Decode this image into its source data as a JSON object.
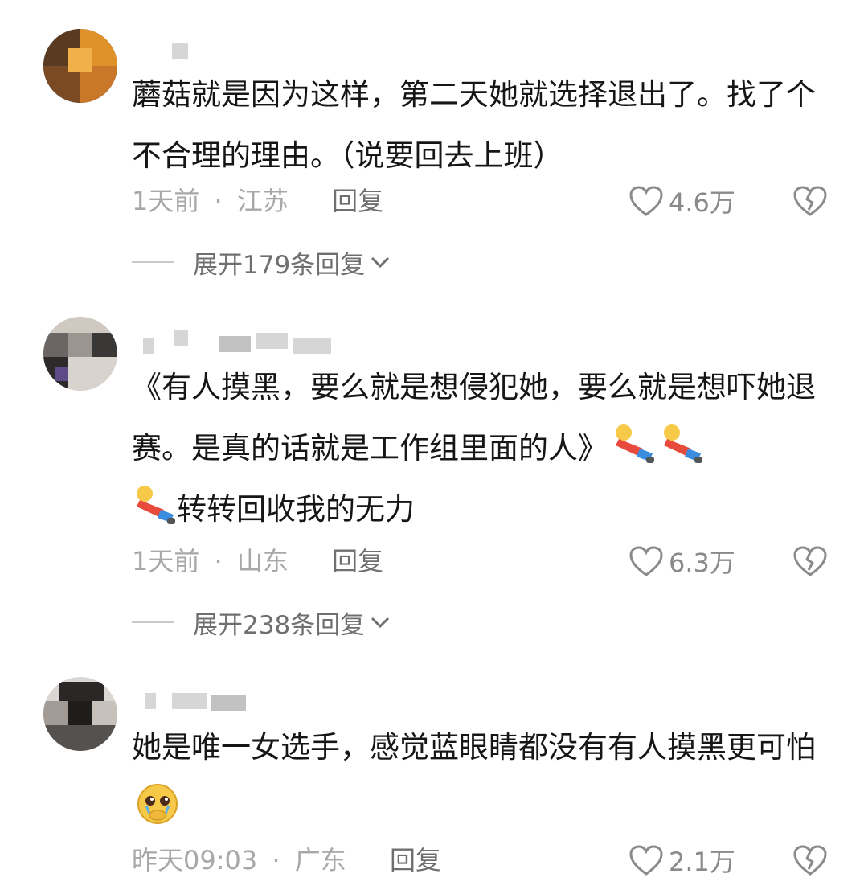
{
  "comments": [
    {
      "text": "蘑菇就是因为这样，第二天她就选择退出了。找了个不合理的理由。（说要回去上班）",
      "time": "1天前",
      "location": "江苏",
      "reply_label": "回复",
      "likes": "4.6万",
      "expand_label": "展开179条回复"
    },
    {
      "text": "《有人摸黑，要么就是想侵犯她，要么就是想吓她退赛。是真的话就是工作组里面的人》",
      "text_line3": "转转回收我的无力",
      "time": "1天前",
      "location": "山东",
      "reply_label": "回复",
      "likes": "6.3万",
      "expand_label": "展开238条回复"
    },
    {
      "text": "她是唯一女选手，感觉蓝眼睛都没有有人摸黑更可怕",
      "time": "昨天09:03",
      "location": "广东",
      "reply_label": "回复",
      "likes": "2.1万"
    }
  ],
  "separator": "·",
  "icons": {
    "like": "heart-outline-icon",
    "dislike": "broken-heart-icon",
    "expand": "chevron-down-icon",
    "emoji_a": "lying-down-figure-emoji",
    "emoji_b": "pleading-face-covering-mouth-emoji"
  },
  "colors": {
    "text": "#161616",
    "meta": "#a8a8a8",
    "reply": "#6f6f6f",
    "icon": "#8a8a8a"
  }
}
